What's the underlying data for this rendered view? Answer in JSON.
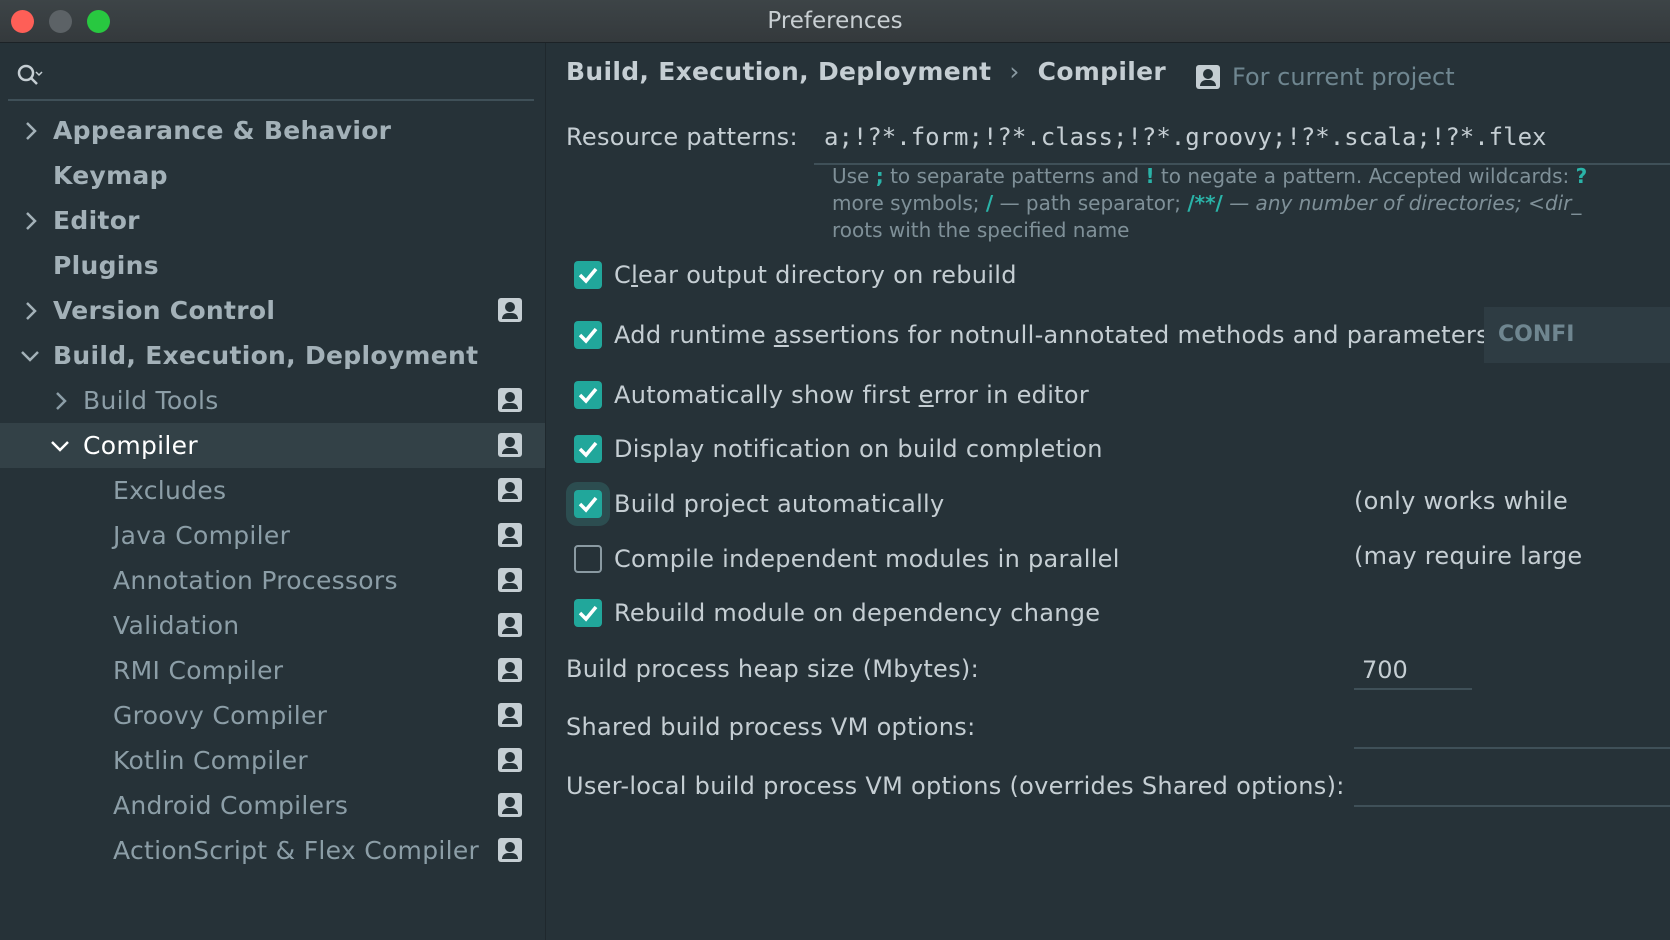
{
  "window": {
    "title": "Preferences"
  },
  "sidebar": {
    "items": [
      {
        "label": "Appearance & Behavior"
      },
      {
        "label": "Keymap"
      },
      {
        "label": "Editor"
      },
      {
        "label": "Plugins"
      },
      {
        "label": "Version Control"
      },
      {
        "label": "Build, Execution, Deployment"
      },
      {
        "label": "Build Tools"
      },
      {
        "label": "Compiler"
      },
      {
        "label": "Excludes"
      },
      {
        "label": "Java Compiler"
      },
      {
        "label": "Annotation Processors"
      },
      {
        "label": "Validation"
      },
      {
        "label": "RMI Compiler"
      },
      {
        "label": "Groovy Compiler"
      },
      {
        "label": "Kotlin Compiler"
      },
      {
        "label": "Android Compilers"
      },
      {
        "label": "ActionScript & Flex Compiler"
      }
    ]
  },
  "main": {
    "breadcrumb": {
      "parent": "Build, Execution, Deployment",
      "separator": "›",
      "current": "Compiler"
    },
    "scope_label": "For current project",
    "resource_patterns": {
      "label": "Resource patterns:",
      "value": "a;!?*.form;!?*.class;!?*.groovy;!?*.scala;!?*.flex",
      "hint_line1_a": "Use ",
      "hint_sym1": ";",
      "hint_line1_b": " to separate patterns and ",
      "hint_sym2": "!",
      "hint_line1_c": " to negate a pattern. Accepted wildcards: ",
      "hint_sym3": "?",
      "hint_line2_a": "more symbols; ",
      "hint_sym4": "/",
      "hint_line2_b": " — path separator; ",
      "hint_sym5": "/**/",
      "hint_line2_c": " — any number of directories; <dir_",
      "hint_line3": "roots with the specified name"
    },
    "checkboxes": [
      {
        "label_pre": "C",
        "label_ul": "l",
        "label_post": "ear output directory on rebuild",
        "checked": true
      },
      {
        "label_pre": "Add runtime ",
        "label_ul": "a",
        "label_post": "ssertions for notnull-annotated methods and parameters",
        "checked": true
      },
      {
        "label_pre": "Automatically show first ",
        "label_ul": "e",
        "label_post": "rror in editor",
        "checked": true
      },
      {
        "label_pre": "Display notification on build completion",
        "label_ul": "",
        "label_post": "",
        "checked": true
      },
      {
        "label_pre": "Build project automatically",
        "label_ul": "",
        "label_post": "",
        "checked": true,
        "note": "(only works while"
      },
      {
        "label_pre": "Compile independent modules in parallel",
        "label_ul": "",
        "label_post": "",
        "checked": false,
        "note": "(may require large"
      },
      {
        "label_pre": "Rebuild module on dependency change",
        "label_ul": "",
        "label_post": "",
        "checked": true
      }
    ],
    "configure_button": "CONFI",
    "heap_size": {
      "label": "Build process heap size (Mbytes):",
      "value": "700"
    },
    "shared_vm": {
      "label": "Shared build process VM options:",
      "value": ""
    },
    "user_vm": {
      "label": "User-local build process VM options (overrides Shared options):",
      "value": ""
    }
  },
  "colors": {
    "accent": "#21a79b",
    "background": "#263238",
    "selected_row": "#334147"
  },
  "icons": [
    "search-icon",
    "chevron-right-icon",
    "chevron-down-icon",
    "project-scope-icon",
    "checkmark-icon"
  ]
}
